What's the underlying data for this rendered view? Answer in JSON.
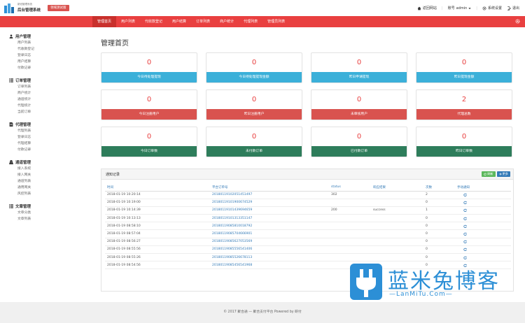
{
  "header": {
    "logo_line1": "新冠管理系统",
    "logo_line2": "后台管理系统",
    "tag": "领域测试版",
    "back_site": "返回网站",
    "account_prefix": "账号",
    "account_user": "admin",
    "settings": "系统设置",
    "logout": "退出"
  },
  "nav": {
    "items": [
      "管理首页",
      "用户列表",
      "代收款登记",
      "用户结算",
      "订单列表",
      "商户统计",
      "代理列表",
      "管理员列表"
    ]
  },
  "sidebar": {
    "groups": [
      {
        "title": "用户管理",
        "icon": "user-icon",
        "items": [
          "用户列表",
          "代收款登记",
          "登录日志",
          "用户结算",
          "付款记录"
        ]
      },
      {
        "title": "订单管理",
        "icon": "list-icon",
        "items": [
          "订单列表",
          "商户统计",
          "通道统计",
          "代理统计",
          "当前订单"
        ]
      },
      {
        "title": "代理管理",
        "icon": "doc-icon",
        "items": [
          "代理列表",
          "登录日志",
          "代理结算",
          "付款记录"
        ]
      },
      {
        "title": "通道管理",
        "icon": "road-icon",
        "items": [
          "接入系统",
          "接入网关",
          "通道列表",
          "通用网关",
          "风控列表"
        ]
      },
      {
        "title": "文章管理",
        "icon": "list-icon",
        "items": [
          "文章分类",
          "文章列表"
        ]
      }
    ]
  },
  "main": {
    "title": "管理首页",
    "cards": [
      {
        "value": "0",
        "label": "今日待处理提现",
        "color": "#3bb0d9"
      },
      {
        "value": "0",
        "label": "今日待处理提现金额",
        "color": "#3bb0d9"
      },
      {
        "value": "0",
        "label": "昨日申请提现",
        "color": "#3bb0d9"
      },
      {
        "value": "0",
        "label": "昨日提现金额",
        "color": "#3bb0d9"
      },
      {
        "value": "0",
        "label": "今日注册用户",
        "color": "#d9534f"
      },
      {
        "value": "0",
        "label": "昨日注册用户",
        "color": "#d9534f"
      },
      {
        "value": "0",
        "label": "未审核用户",
        "color": "#d9534f"
      },
      {
        "value": "2",
        "label": "代理总数",
        "color": "#d9534f"
      },
      {
        "value": "0",
        "label": "今日订单数",
        "color": "#2e7d5b"
      },
      {
        "value": "0",
        "label": "未付款订单",
        "color": "#2e7d5b"
      },
      {
        "value": "0",
        "label": "已付款订单",
        "color": "#2e7d5b"
      },
      {
        "value": "0",
        "label": "昨日订单数",
        "color": "#2e7d5b"
      }
    ],
    "panel": {
      "title": "通知记录",
      "btn_refresh": "刷新",
      "btn_more": "更多",
      "columns": [
        "时间",
        "平台订单号",
        "status",
        "响应结果",
        "次数",
        "手动通知"
      ],
      "rows": [
        {
          "time": "2018-01-19 10:20:14",
          "order": "20180119102051451497",
          "status": "302",
          "result": "",
          "count": "2"
        },
        {
          "time": "2018-01-19 10:19:00",
          "order": "20180119101900674529",
          "status": "",
          "result": "",
          "count": "0"
        },
        {
          "time": "2018-01-19 10:14:39",
          "order": "20180119101439694659",
          "status": "200",
          "result": "success",
          "count": "1"
        },
        {
          "time": "2018-01-19 10:13:13",
          "order": "20180119101313351147",
          "status": "",
          "result": "",
          "count": "0"
        },
        {
          "time": "2018-01-19 08:58:10",
          "order": "20180119085810018792",
          "status": "",
          "result": "",
          "count": "0"
        },
        {
          "time": "2018-01-19 08:57:04",
          "order": "20180119085704666901",
          "status": "",
          "result": "",
          "count": "0"
        },
        {
          "time": "2018-01-19 08:56:27",
          "order": "20180119085627053569",
          "status": "",
          "result": "",
          "count": "0"
        },
        {
          "time": "2018-01-19 08:55:56",
          "order": "20180119085556541406",
          "status": "",
          "result": "",
          "count": "0"
        },
        {
          "time": "2018-01-19 08:55:26",
          "order": "20180119085526678113",
          "status": "",
          "result": "",
          "count": "0"
        },
        {
          "time": "2018-01-19 08:54:56",
          "order": "20180119085456541968",
          "status": "",
          "result": "",
          "count": "0"
        }
      ]
    }
  },
  "footer": {
    "text": "© 2017 聚合通 — 聚合支付平台 Powered by 研付"
  },
  "watermark": {
    "title": "蓝米兔博客",
    "url": "—LanMiTu.Com—"
  },
  "colors": {
    "primary_red": "#e94040",
    "info": "#3bb0d9",
    "danger": "#d9534f",
    "success": "#2e7d5b",
    "link": "#337ab7"
  }
}
